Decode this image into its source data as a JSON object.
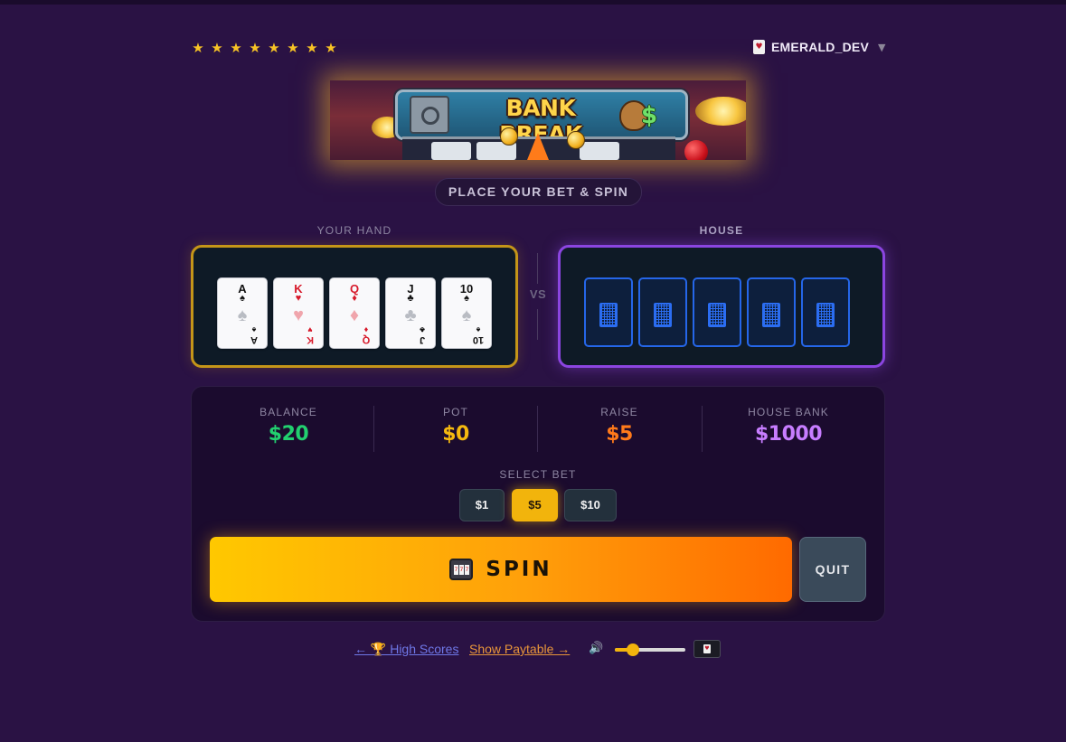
{
  "header": {
    "stars": [
      "★",
      "★",
      "★",
      "★",
      "★",
      "★",
      "★",
      "★"
    ],
    "user": {
      "icon": "playing-card-icon",
      "name": "EMERALD_DEV",
      "caret": "▼"
    }
  },
  "banner": {
    "title": "BANK BREAK",
    "dollar": "$"
  },
  "prompt": "PLACE YOUR BET & SPIN",
  "hand": {
    "label": "YOUR HAND",
    "cards": [
      {
        "rank": "A",
        "suit": "♠",
        "color": "black"
      },
      {
        "rank": "K",
        "suit": "♥",
        "color": "red"
      },
      {
        "rank": "Q",
        "suit": "♦",
        "color": "red"
      },
      {
        "rank": "J",
        "suit": "♣",
        "color": "black"
      },
      {
        "rank": "10",
        "suit": "♠",
        "color": "black"
      }
    ]
  },
  "vs": "VS",
  "house": {
    "label": "HOUSE",
    "face_down_count": 5
  },
  "stats": [
    {
      "label": "BALANCE",
      "value": "$20",
      "color": "#22d06f"
    },
    {
      "label": "POT",
      "value": "$0",
      "color": "#f5b90f"
    },
    {
      "label": "RAISE",
      "value": "$5",
      "color": "#ff7a1a"
    },
    {
      "label": "HOUSE BANK",
      "value": "$1000",
      "color": "#c77dff"
    }
  ],
  "bet": {
    "label": "SELECT BET",
    "options": [
      "$1",
      "$5",
      "$10"
    ],
    "selected": "$5"
  },
  "actions": {
    "spin": "SPIN",
    "quit": "QUIT"
  },
  "footer": {
    "scores_link": "← 🏆 High Scores",
    "paytable_link": "Show Paytable →",
    "volume_icon": "🔊",
    "volume_level": 0.25
  },
  "colors": {
    "background": "#2a1244",
    "hand_border": "#c49518",
    "house_border": "#8b45e0",
    "accent": "#f2b40c"
  }
}
